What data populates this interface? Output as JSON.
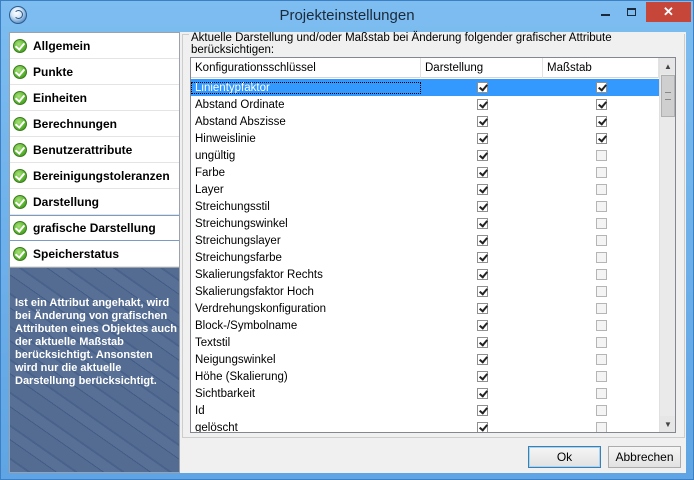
{
  "window": {
    "title": "Projekteinstellungen",
    "close_glyph": "✕"
  },
  "sidebar": {
    "items": [
      {
        "label": "Allgemein",
        "selected": false
      },
      {
        "label": "Punkte",
        "selected": false
      },
      {
        "label": "Einheiten",
        "selected": false
      },
      {
        "label": "Berechnungen",
        "selected": false
      },
      {
        "label": "Benutzerattribute",
        "selected": false
      },
      {
        "label": "Bereinigungstoleranzen",
        "selected": false
      },
      {
        "label": "Darstellung",
        "selected": false
      },
      {
        "label": "grafische Darstellung",
        "selected": true
      },
      {
        "label": "Speicherstatus",
        "selected": false
      }
    ],
    "help_text": "Ist ein Attribut angehakt, wird bei Änderung von grafischen Attributen eines Objektes auch der aktuelle Maßstab berücksichtigt. Ansonsten wird nur die aktuelle Darstellung berücksichtigt."
  },
  "main": {
    "group_label": "Aktuelle Darstellung und/oder Maßstab bei Änderung folgender grafischer Attribute berücksichtigen:",
    "columns": [
      "Konfigurationsschlüssel",
      "Darstellung",
      "Maßstab"
    ],
    "rows": [
      {
        "name": "Linientypfaktor",
        "darstellung": true,
        "massstab": true,
        "selected": true
      },
      {
        "name": "Abstand Ordinate",
        "darstellung": true,
        "massstab": true
      },
      {
        "name": "Abstand Abszisse",
        "darstellung": true,
        "massstab": true
      },
      {
        "name": "Hinweislinie",
        "darstellung": true,
        "massstab": true
      },
      {
        "name": "ungültig",
        "darstellung": true,
        "massstab": false
      },
      {
        "name": "Farbe",
        "darstellung": true,
        "massstab": false
      },
      {
        "name": "Layer",
        "darstellung": true,
        "massstab": false
      },
      {
        "name": "Streichungsstil",
        "darstellung": true,
        "massstab": false
      },
      {
        "name": "Streichungswinkel",
        "darstellung": true,
        "massstab": false
      },
      {
        "name": "Streichungslayer",
        "darstellung": true,
        "massstab": false
      },
      {
        "name": "Streichungsfarbe",
        "darstellung": true,
        "massstab": false
      },
      {
        "name": "Skalierungsfaktor Rechts",
        "darstellung": true,
        "massstab": false
      },
      {
        "name": "Skalierungsfaktor Hoch",
        "darstellung": true,
        "massstab": false
      },
      {
        "name": "Verdrehungskonfiguration",
        "darstellung": true,
        "massstab": false
      },
      {
        "name": "Block-/Symbolname",
        "darstellung": true,
        "massstab": false
      },
      {
        "name": "Textstil",
        "darstellung": true,
        "massstab": false
      },
      {
        "name": "Neigungswinkel",
        "darstellung": true,
        "massstab": false
      },
      {
        "name": "Höhe (Skalierung)",
        "darstellung": true,
        "massstab": false
      },
      {
        "name": "Sichtbarkeit",
        "darstellung": true,
        "massstab": false
      },
      {
        "name": "Id",
        "darstellung": true,
        "massstab": false
      },
      {
        "name": "gelöscht",
        "darstellung": true,
        "massstab": false
      }
    ]
  },
  "buttons": {
    "ok": "Ok",
    "cancel": "Abbrechen"
  },
  "scrollbar": {
    "up_glyph": "▲",
    "down_glyph": "▼"
  },
  "colors": {
    "selection": "#3399ff",
    "check": "#58b22d"
  }
}
